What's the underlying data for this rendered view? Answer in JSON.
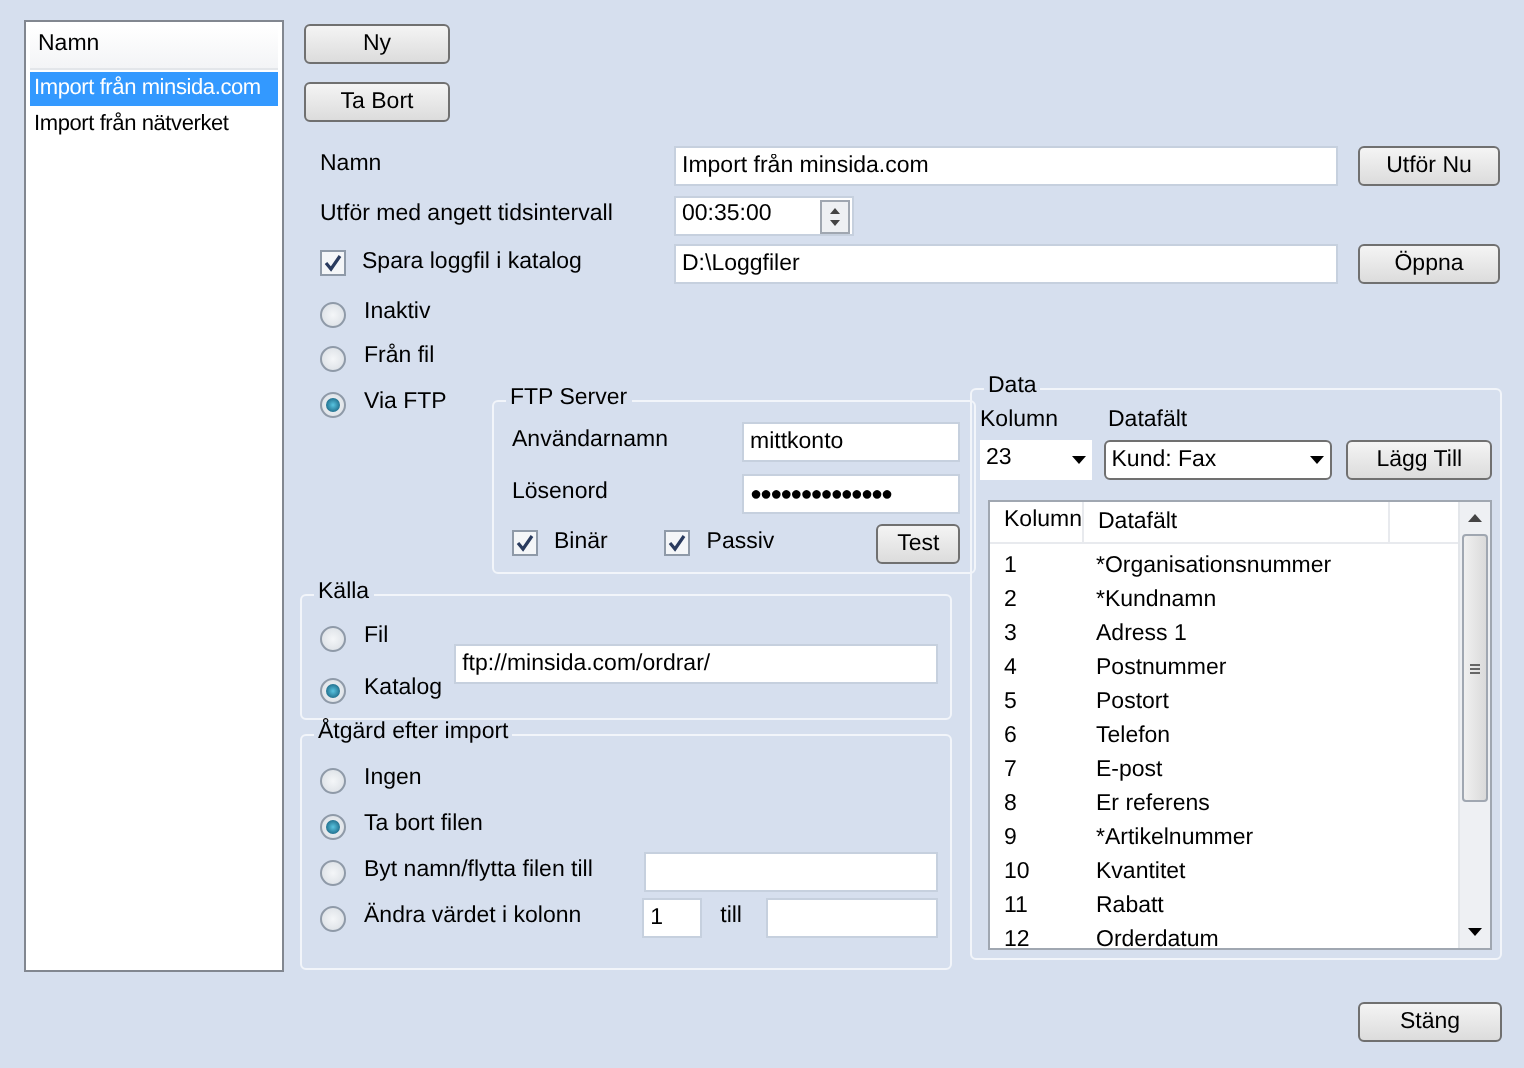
{
  "list": {
    "header": "Namn",
    "items": [
      {
        "label": "Import från minsida.com",
        "selected": true
      },
      {
        "label": "Import från nätverket",
        "selected": false
      }
    ]
  },
  "top_buttons": [
    "Ny",
    "Ta Bort"
  ],
  "name_row": {
    "label": "Namn",
    "value": "Import från minsida.com",
    "button": "Utför Nu"
  },
  "interval_row": {
    "label": "Utför med angett tidsintervall",
    "value": "00:35:00"
  },
  "log_row": {
    "label": "Spara loggfil i katalog",
    "checked": true,
    "value": "D:\\Loggfiler",
    "button": "Öppna"
  },
  "mode_options": [
    {
      "label": "Inaktiv",
      "selected": false
    },
    {
      "label": "Från fil",
      "selected": false
    },
    {
      "label": "Via FTP",
      "selected": true
    }
  ],
  "ftp": {
    "title": "FTP Server",
    "username_label": "Användarnamn",
    "username": "mittkonto",
    "password_label": "Lösenord",
    "password": "●●●●●●●●●●●●●●",
    "checks": [
      {
        "label": "Binär",
        "checked": true
      },
      {
        "label": "Passiv",
        "checked": true
      }
    ],
    "test_button": "Test"
  },
  "source": {
    "title": "Källa",
    "options": [
      {
        "label": "Fil",
        "selected": false
      },
      {
        "label": "Katalog",
        "selected": true
      }
    ],
    "path": "ftp://minsida.com/ordrar/"
  },
  "after_import": {
    "title": "Åtgärd efter import",
    "options": [
      {
        "kind": "plain",
        "label": "Ingen",
        "selected": false
      },
      {
        "kind": "plain",
        "label": "Ta bort filen",
        "selected": true
      },
      {
        "kind": "rename",
        "label": "Byt namn/flytta filen till",
        "selected": false
      },
      {
        "kind": "change",
        "label": "Ändra värdet i kolonn",
        "selected": false,
        "column": "1",
        "to_label": "till"
      }
    ]
  },
  "data": {
    "title": "Data",
    "column_label": "Kolumn",
    "column_value": "23",
    "field_label": "Datafält",
    "field_value": "Kund: Fax",
    "add_button": "Lägg Till",
    "table": {
      "columns": [
        "Kolumn",
        "Datafält"
      ],
      "rows": [
        [
          "1",
          "*Organisationsnummer"
        ],
        [
          "2",
          "*Kundnamn"
        ],
        [
          "3",
          "Adress 1"
        ],
        [
          "4",
          "Postnummer"
        ],
        [
          "5",
          "Postort"
        ],
        [
          "6",
          "Telefon"
        ],
        [
          "7",
          "E-post"
        ],
        [
          "8",
          "Er referens"
        ],
        [
          "9",
          "*Artikelnummer"
        ],
        [
          "10",
          "Kvantitet"
        ],
        [
          "11",
          "Rabatt"
        ],
        [
          "12",
          "Orderdatum"
        ]
      ]
    }
  },
  "close_button": "Stäng"
}
